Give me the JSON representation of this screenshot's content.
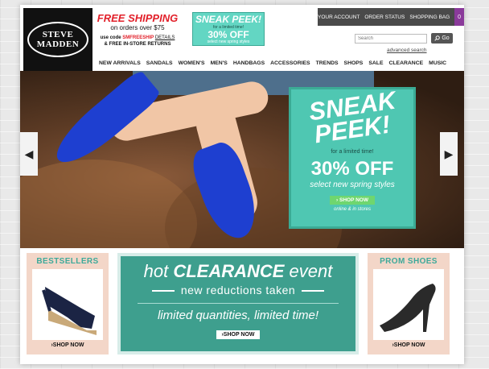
{
  "brand": {
    "line1": "STEVE",
    "line2": "MADDEN"
  },
  "shipping": {
    "title": "FREE SHIPPING",
    "subtitle": "on orders over $75",
    "code_prefix": "use code ",
    "code": "SMFREESHIP",
    "details": "DETAILS",
    "returns": "& FREE IN-STORE RETURNS"
  },
  "mini_banner": {
    "title": "SNEAK PEEK!",
    "limited": "for a limited time!",
    "offer": "30% OFF",
    "styles": "select new spring styles"
  },
  "util": {
    "account": "YOUR ACCOUNT",
    "order_status": "ORDER STATUS",
    "bag": "SHOPPING BAG",
    "bag_count": "0"
  },
  "search": {
    "placeholder": "Search",
    "go": "Go",
    "advanced": "advanced search"
  },
  "nav": [
    "NEW ARRIVALS",
    "SANDALS",
    "WOMEN'S",
    "MEN'S",
    "HANDBAGS",
    "ACCESSORIES",
    "TRENDS",
    "SHOPS",
    "SALE",
    "CLEARANCE",
    "MUSIC"
  ],
  "hero": {
    "sneak": "SNEAK",
    "peek": "PEEK!",
    "limited": "for a limited time!",
    "offer": "30% OFF",
    "styles": "select new spring styles",
    "shop": "› SHOP NOW",
    "online": "online & in stores"
  },
  "tiles": {
    "bestsellers": {
      "title": "BESTSELLERS",
      "shop": "›SHOP NOW"
    },
    "prom": {
      "title": "PROM SHOES",
      "shop": "›SHOP NOW"
    }
  },
  "clearance": {
    "title_pre": "hot ",
    "title_bold": "CLEARANCE",
    "title_post": " event",
    "sub": "new reductions taken",
    "limited": "limited quantities, limited time!",
    "shop": "›SHOP NOW"
  },
  "colors": {
    "teal": "#4fc7b2",
    "red": "#e2202a",
    "purple": "#8a3a9a",
    "shoe_blue": "#1e3fd0"
  }
}
